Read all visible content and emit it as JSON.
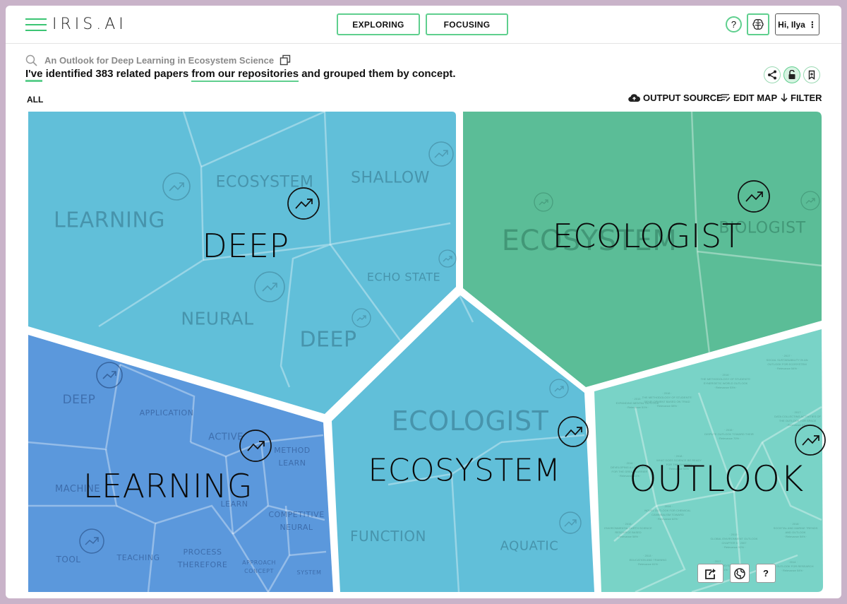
{
  "header": {
    "logo": "IRIS.AI",
    "modes": {
      "exploring": "EXPLORING",
      "focusing": "FOCUSING"
    },
    "help": "?",
    "user": "Hi, Ilya",
    "user_menu": "⋮"
  },
  "query": {
    "title": "An Outlook for Deep Learning in Ecosystem Science",
    "summary_part1": "I've",
    "summary_part2": " identified 383 related papers ",
    "summary_link": "from our repositories",
    "summary_part3": " and grouped them by concept."
  },
  "toolbar": {
    "all": "ALL",
    "output_source": "OUTPUT SOURCE",
    "edit_map": "EDIT MAP",
    "filter": "FILTER"
  },
  "colors": {
    "accent": "#5fcf8e",
    "cyan_cell": "#61bfd9",
    "green_cell": "#5bbd97",
    "blue_cell": "#5b98dc",
    "teal_cell": "#79d3c7"
  },
  "map": {
    "deep": {
      "title": "DEEP",
      "subs": [
        "LEARNING",
        "ECOSYSTEM",
        "SHALLOW",
        "ECHO STATE",
        "NEURAL",
        "DEEP"
      ]
    },
    "ecologist": {
      "title": "ECOLOGIST",
      "subs": [
        "ECOSYSTEM",
        "BIOLOGIST"
      ]
    },
    "learning": {
      "title": "LEARNING",
      "subs": [
        "DEEP",
        "APPLICATION",
        "ACTIVE",
        "METHOD\nLEARN",
        "MACHINE",
        "LEARN",
        "COMPETITIVE\nNEURAL",
        "TOOL",
        "TEACHING",
        "PROCESS\nTHEREFORE",
        "APPROACH\nCONCEPT",
        "SYSTEM"
      ]
    },
    "ecosystem": {
      "title": "ECOSYSTEM",
      "subs": [
        "ECOLOGIST",
        "FUNCTION",
        "AQUATIC"
      ]
    },
    "outlook": {
      "title": "OUTLOOK"
    }
  },
  "footer_tools": {
    "help": "?"
  }
}
